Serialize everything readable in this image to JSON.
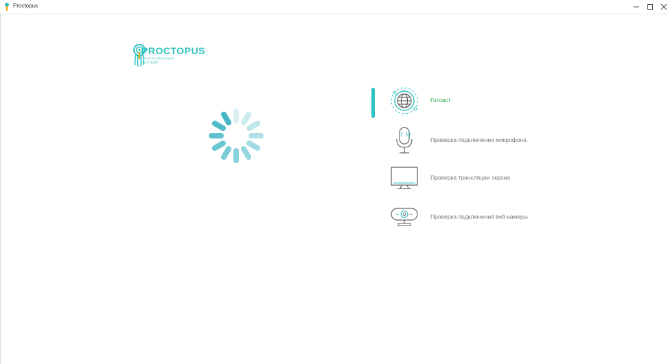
{
  "window": {
    "title": "Proctopus"
  },
  "logo": {
    "name": "PROCTOPUS",
    "subtitle": "ПРОКТОРИНГОВАЯ СИСТЕМА"
  },
  "checklist": {
    "steps": [
      {
        "label": "Готово!",
        "icon": "globe-icon",
        "state": "done"
      },
      {
        "label": "Проверка подключения микрофона",
        "icon": "microphone-icon",
        "state": "pending"
      },
      {
        "label": "Проверка трансляции экрана",
        "icon": "monitor-icon",
        "state": "pending"
      },
      {
        "label": "Проверка подключения веб-камеры",
        "icon": "webcam-icon",
        "state": "pending"
      }
    ]
  },
  "colors": {
    "brand": "#2fc2c0",
    "success": "#27a844",
    "muted_text": "#777777"
  }
}
